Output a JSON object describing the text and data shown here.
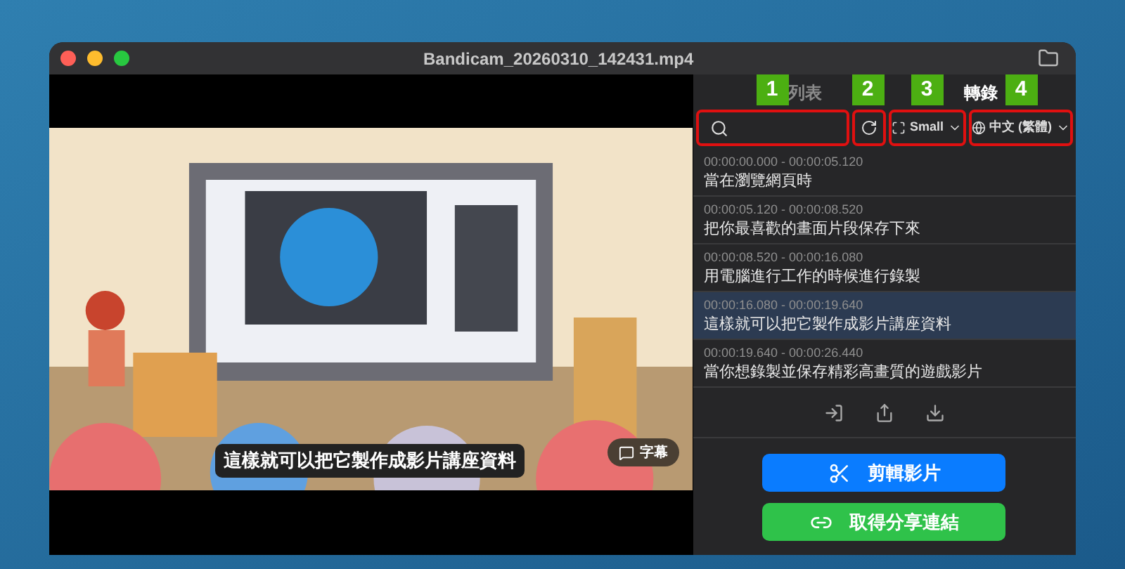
{
  "window": {
    "title": "Bandicam_20260310_142431.mp4"
  },
  "player": {
    "subtitle": "這樣就可以把它製作成影片講座資料",
    "captions_button": "字幕"
  },
  "tabs": [
    {
      "label": "列表",
      "selected": false,
      "callout": "1"
    },
    {
      "label": "轉錄",
      "selected": true,
      "callout": "4"
    }
  ],
  "toolbar": {
    "search": {
      "highlighted": true
    },
    "refresh": {
      "highlighted": true,
      "callout": "2"
    },
    "size": {
      "value": "Small",
      "highlighted": true,
      "callout": "3"
    },
    "language": {
      "value": "中文 (繁體)",
      "highlighted": true
    }
  },
  "transcript": [
    {
      "time": "00:00:00.000 - 00:00:05.120",
      "text": "當在瀏覽網頁時",
      "selected": false
    },
    {
      "time": "00:00:05.120 - 00:00:08.520",
      "text": "把你最喜歡的畫面片段保存下來",
      "selected": false
    },
    {
      "time": "00:00:08.520 - 00:00:16.080",
      "text": "用電腦進行工作的時候進行錄製",
      "selected": false
    },
    {
      "time": "00:00:16.080 - 00:00:19.640",
      "text": "這樣就可以把它製作成影片講座資料",
      "selected": true
    },
    {
      "time": "00:00:19.640 - 00:00:26.440",
      "text": "當你想錄製並保存精彩高畫質的遊戲影片",
      "selected": false
    }
  ],
  "buttons": [
    {
      "kind": "edit",
      "label": "剪輯影片"
    },
    {
      "kind": "share",
      "label": "取得分享連結"
    }
  ]
}
